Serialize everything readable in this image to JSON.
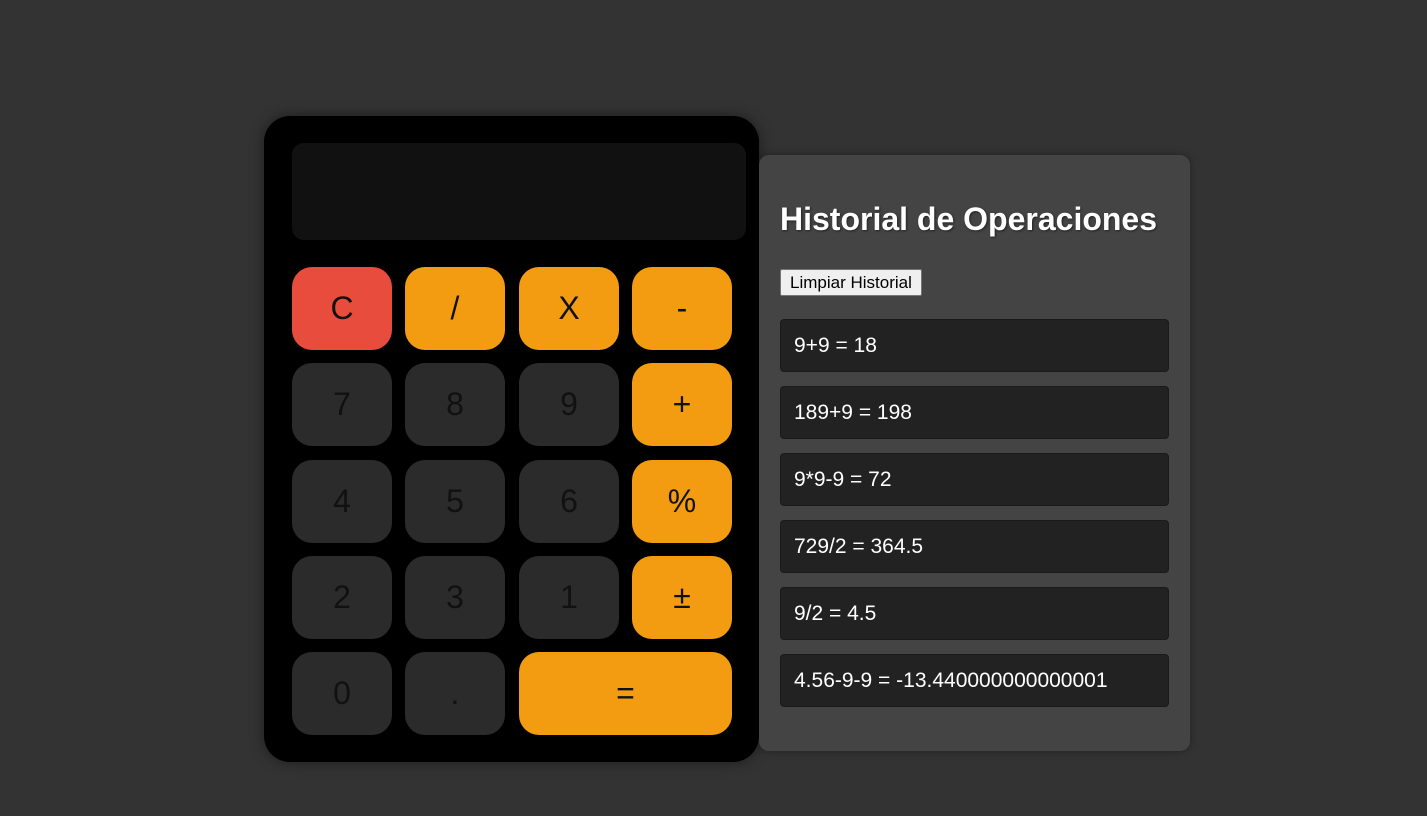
{
  "calculator": {
    "display_value": "",
    "buttons": {
      "clear": "C",
      "divide": "/",
      "multiply": "X",
      "subtract": "-",
      "seven": "7",
      "eight": "8",
      "nine": "9",
      "add": "+",
      "four": "4",
      "five": "5",
      "six": "6",
      "percent": "%",
      "two": "2",
      "three": "3",
      "one": "1",
      "plus_minus": "±",
      "zero": "0",
      "decimal": ".",
      "equals": "="
    }
  },
  "history": {
    "title": "Historial de Operaciones",
    "clear_label": "Limpiar Historial",
    "items": [
      "9+9 = 18",
      "189+9 = 198",
      "9*9-9 = 72",
      "729/2 = 364.5",
      "9/2 = 4.5",
      "4.56-9-9 = -13.440000000000001"
    ]
  },
  "colors": {
    "background": "#333333",
    "calculator_body": "#000000",
    "display": "#111111",
    "clear_button": "#e74c3c",
    "operator_button": "#f39c12",
    "number_button": "#2b2b2b",
    "history_panel": "#444444",
    "history_item": "#222222"
  }
}
